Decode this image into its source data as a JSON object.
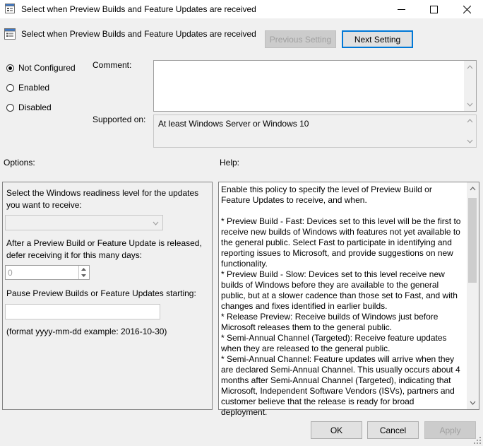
{
  "window": {
    "title": "Select when Preview Builds and Feature Updates are received",
    "controls": [
      "minimize",
      "maximize",
      "close"
    ]
  },
  "header": {
    "policy_title": "Select when Preview Builds and Feature Updates are received",
    "previous_label": "Previous Setting",
    "next_label": "Next Setting"
  },
  "state": {
    "options": [
      "Not Configured",
      "Enabled",
      "Disabled"
    ],
    "selected": "Not Configured"
  },
  "comment": {
    "label": "Comment:",
    "value": ""
  },
  "supported": {
    "label": "Supported on:",
    "value": "At least Windows Server or Windows 10"
  },
  "options_panel": {
    "heading": "Options:",
    "readiness_label": "Select the Windows readiness level for the updates you want to receive:",
    "readiness_value": "",
    "defer_label": "After a Preview Build or Feature Update is released, defer receiving it for this many days:",
    "defer_value": "0",
    "pause_label": "Pause Preview Builds or Feature Updates starting:",
    "pause_value": "",
    "format_hint": "(format yyyy-mm-dd example: 2016-10-30)"
  },
  "help_panel": {
    "heading": "Help:",
    "paragraphs": [
      "Enable this policy to specify the level of Preview Build or Feature Updates to receive, and when.",
      "",
      "* Preview Build - Fast: Devices set to this level will be the first to receive new builds of Windows with features not yet available to the general public. Select Fast to participate in identifying and reporting issues to Microsoft, and provide suggestions on new functionality.",
      "* Preview Build - Slow: Devices set to this level receive new builds of Windows before they are available to the general public, but at a slower cadence than those set to Fast, and with changes and fixes identified in earlier builds.",
      "* Release Preview: Receive builds of Windows just before Microsoft releases them to the general public.",
      "* Semi-Annual Channel (Targeted): Receive feature updates when they are released to the general public.",
      "* Semi-Annual Channel: Feature updates will arrive when they are declared Semi-Annual Channel. This usually occurs about 4 months after Semi-Annual Channel (Targeted), indicating that Microsoft, Independent Software Vendors (ISVs), partners and customer believe that the release is ready for broad deployment."
    ]
  },
  "footer": {
    "ok_label": "OK",
    "cancel_label": "Cancel",
    "apply_label": "Apply"
  },
  "colors": {
    "accent": "#0078d7",
    "disabled_text": "#a0a0a0"
  }
}
